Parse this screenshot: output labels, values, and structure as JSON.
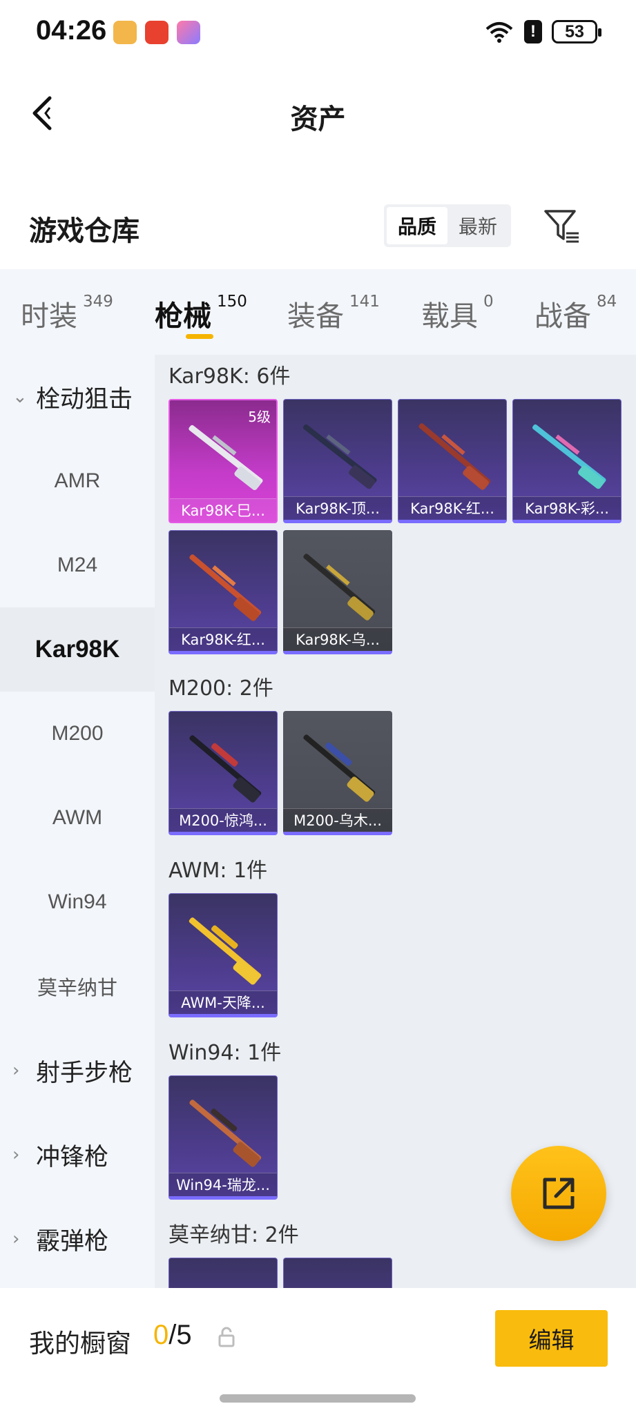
{
  "status_bar": {
    "time": "04:26",
    "battery": "53",
    "alert": "!",
    "app_icons": [
      "app-icon-orange",
      "app-icon-red-camera",
      "app-icon-gradient"
    ],
    "icons": [
      "wifi-icon",
      "battery-icon"
    ]
  },
  "nav": {
    "title": "资产",
    "back_icon": "chevron-left-icon"
  },
  "warehouse": {
    "title": "游戏仓库",
    "sort_options": [
      "品质",
      "最新"
    ],
    "sort_selected": "品质",
    "filter_icon": "filter-icon"
  },
  "tabs": [
    {
      "label": "时装",
      "count": "349"
    },
    {
      "label": "枪械",
      "count": "150"
    },
    {
      "label": "装备",
      "count": "141"
    },
    {
      "label": "载具",
      "count": "0"
    },
    {
      "label": "战备",
      "count": "84"
    }
  ],
  "active_tab": "枪械",
  "sidebar": {
    "items": [
      {
        "label": "栓动狙击",
        "type": "parent",
        "caret": "expanded"
      },
      {
        "label": "AMR",
        "type": "child"
      },
      {
        "label": "M24",
        "type": "child"
      },
      {
        "label": "Kar98K",
        "type": "child",
        "active": true
      },
      {
        "label": "M200",
        "type": "child"
      },
      {
        "label": "AWM",
        "type": "child"
      },
      {
        "label": "Win94",
        "type": "child"
      },
      {
        "label": "莫辛纳甘",
        "type": "child"
      },
      {
        "label": "射手步枪",
        "type": "parent",
        "caret": "collapsed"
      },
      {
        "label": "冲锋枪",
        "type": "parent",
        "caret": "collapsed"
      },
      {
        "label": "霰弹枪",
        "type": "parent",
        "caret": "collapsed"
      }
    ]
  },
  "groups": [
    {
      "title": "Kar98K: 6件",
      "items": [
        {
          "name": "Kar98K-巳...",
          "rarity": "pink",
          "level": "5级"
        },
        {
          "name": "Kar98K-顶...",
          "rarity": "purple"
        },
        {
          "name": "Kar98K-红...",
          "rarity": "purple"
        },
        {
          "name": "Kar98K-彩...",
          "rarity": "purple"
        },
        {
          "name": "Kar98K-红...",
          "rarity": "purple"
        },
        {
          "name": "Kar98K-乌...",
          "rarity": "gray"
        }
      ]
    },
    {
      "title": "M200: 2件",
      "items": [
        {
          "name": "M200-惊鸿...",
          "rarity": "purple"
        },
        {
          "name": "M200-乌木...",
          "rarity": "gray"
        }
      ]
    },
    {
      "title": "AWM: 1件",
      "items": [
        {
          "name": "AWM-天降...",
          "rarity": "purple"
        }
      ]
    },
    {
      "title": "Win94: 1件",
      "items": [
        {
          "name": "Win94-瑞龙...",
          "rarity": "purple"
        }
      ]
    },
    {
      "title": "莫辛纳甘: 2件",
      "items": [
        {
          "name": "",
          "rarity": "purple"
        },
        {
          "name": "",
          "rarity": "purple"
        }
      ]
    }
  ],
  "fab": {
    "icon": "external-share-icon"
  },
  "bottom": {
    "showcase_label": "我的橱窗",
    "showcase_current": "0",
    "showcase_total": "/5",
    "lock_icon": "lock-icon",
    "edit_label": "编辑"
  },
  "colors": {
    "accent": "#f5b400",
    "purple_rarity": "#7a6cff",
    "pink_rarity": "#d943d8"
  }
}
